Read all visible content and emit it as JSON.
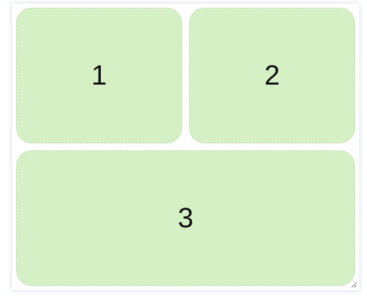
{
  "grid": {
    "cells": [
      {
        "label": "1"
      },
      {
        "label": "2"
      },
      {
        "label": "3"
      }
    ]
  },
  "colors": {
    "cell_background": "#d6f0c6",
    "cell_border": "#c4d8b8",
    "container_background": "#ffffff"
  },
  "icons": {
    "resize_handle": "resize-grip-icon"
  }
}
